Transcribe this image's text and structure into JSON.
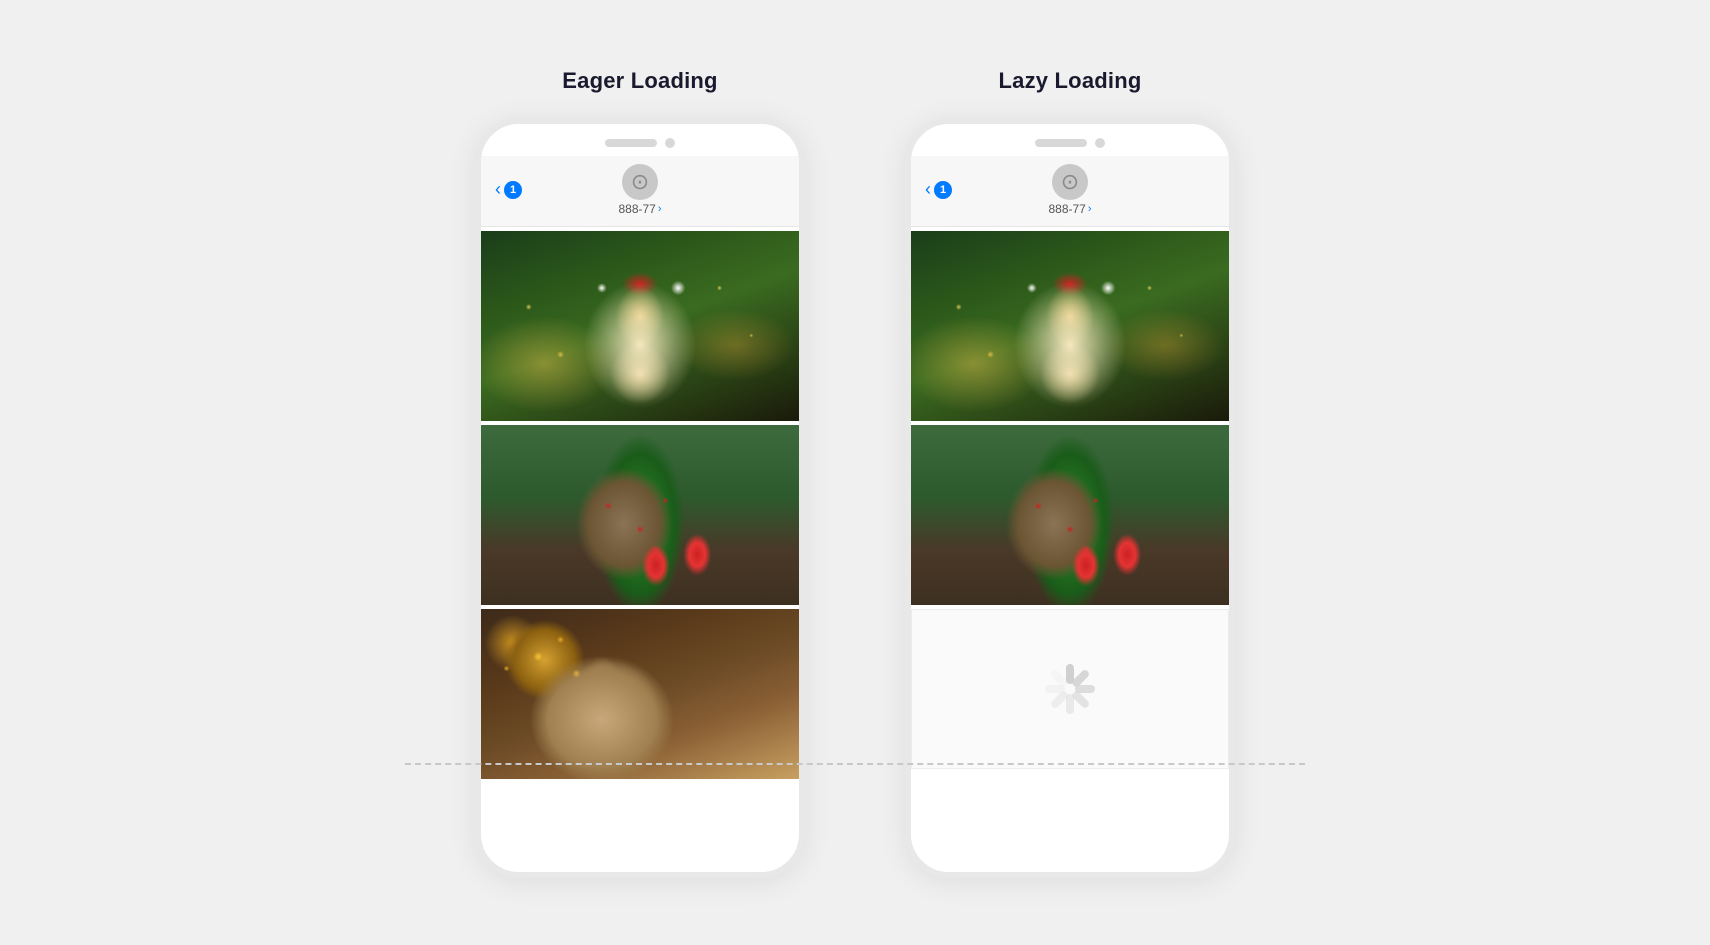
{
  "page": {
    "background": "#f0f0f0",
    "separator_style": "dashed"
  },
  "eager": {
    "title": "Eager Loading",
    "back_badge": "1",
    "contact_number": "888-77",
    "images": [
      {
        "id": "dog-santa",
        "alt": "Dog wearing santa hat with christmas tree"
      },
      {
        "id": "bulldog-tree",
        "alt": "Bulldog dressed as christmas tree"
      },
      {
        "id": "cat-xmas",
        "alt": "Cat with christmas decorations"
      }
    ]
  },
  "lazy": {
    "title": "Lazy Loading",
    "back_badge": "1",
    "contact_number": "888-77",
    "images": [
      {
        "id": "dog-santa",
        "alt": "Dog wearing santa hat with christmas tree"
      },
      {
        "id": "bulldog-tree",
        "alt": "Bulldog dressed as christmas tree"
      }
    ],
    "loading_slot": {
      "visible": true,
      "alt": "Loading spinner - image not yet loaded"
    }
  }
}
